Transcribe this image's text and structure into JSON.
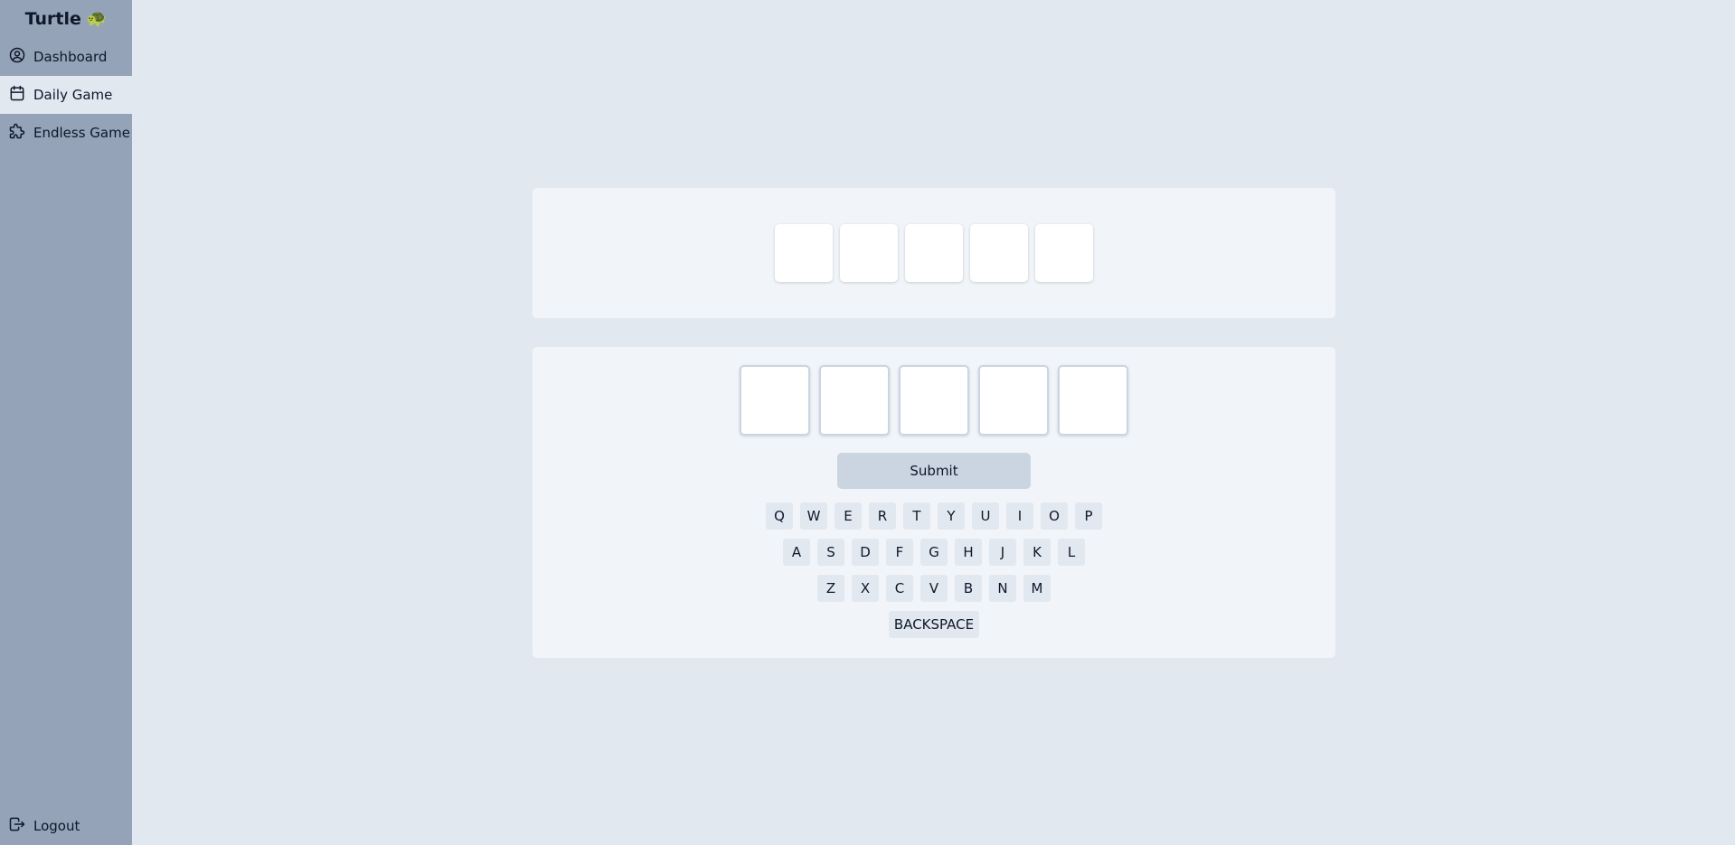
{
  "sidebar": {
    "brand": "Turtle",
    "brand_emoji": "🐢",
    "items": [
      {
        "label": "Dashboard",
        "icon": "user-circle-icon"
      },
      {
        "label": "Daily Game",
        "icon": "calendar-icon"
      },
      {
        "label": "Endless Game",
        "icon": "puzzle-icon"
      }
    ],
    "logout": {
      "label": "Logout",
      "icon": "logout-icon"
    }
  },
  "game": {
    "board_tiles": [
      "",
      "",
      "",
      "",
      ""
    ],
    "input_letters": [
      "",
      "",
      "",
      "",
      ""
    ],
    "submit_label": "Submit",
    "keyboard": {
      "row1": [
        "Q",
        "W",
        "E",
        "R",
        "T",
        "Y",
        "U",
        "I",
        "O",
        "P"
      ],
      "row2": [
        "A",
        "S",
        "D",
        "F",
        "G",
        "H",
        "J",
        "K",
        "L"
      ],
      "row3": [
        "Z",
        "X",
        "C",
        "V",
        "B",
        "N",
        "M"
      ],
      "backspace": "BACKSPACE"
    }
  },
  "colors": {
    "background": "#e2e8f0",
    "sidebar": "#94a3b8",
    "panel": "#f1f5f9",
    "button": "#cbd5e1"
  }
}
